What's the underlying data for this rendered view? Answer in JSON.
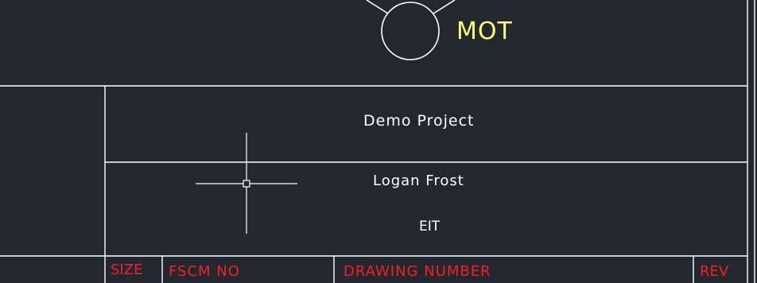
{
  "title_block": {
    "logo_label": "MOT",
    "project_title": "Demo Project",
    "engineer_name": "Logan Frost",
    "engineer_designation": "EIT"
  },
  "footer": {
    "size_label": "SIZE",
    "fscm_label": "FSCM NO",
    "drawing_number_label": "DRAWING NUMBER",
    "rev_label": "REV"
  },
  "colors": {
    "background": "#212830",
    "line": "#ffffff",
    "logo_text": "#ffff66",
    "footer_text": "#ff1c1c"
  },
  "icons": [
    "mot-logo-circle-icon",
    "crosshair-cursor-icon"
  ]
}
